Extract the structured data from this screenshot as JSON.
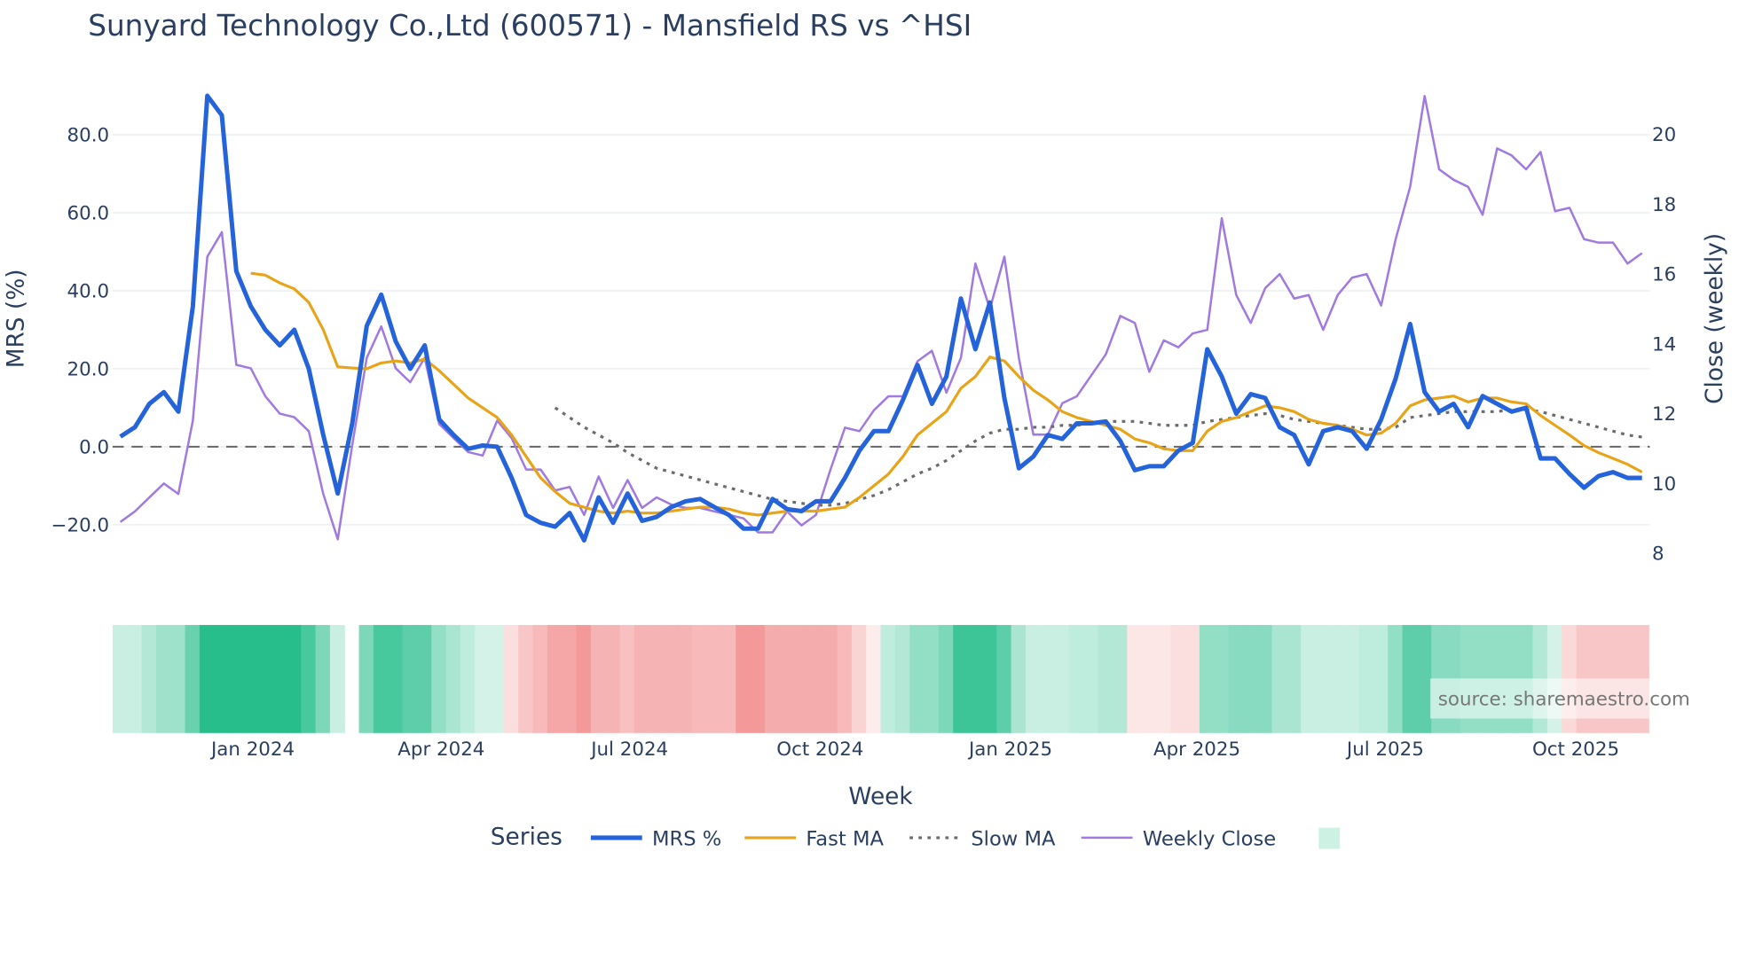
{
  "chart_data": {
    "type": "line",
    "title": "Sunyard Technology Co.,Ltd (600571) - Mansfield RS vs ^HSI",
    "xlabel": "Week",
    "ylabel": "MRS (%)",
    "y2label": "Close (weekly)",
    "x_start": "2023-10-29",
    "x_step_days": 7,
    "ylim": [
      -28,
      92
    ],
    "y2lim": [
      7.7,
      21.4
    ],
    "yticks": [
      "80.0",
      "60.0",
      "40.0",
      "20.0",
      "0.0",
      "−20.0"
    ],
    "ytick_values": [
      80,
      60,
      40,
      20,
      0,
      -20
    ],
    "y2ticks": [
      "20",
      "18",
      "16",
      "14",
      "12",
      "10",
      "8"
    ],
    "y2tick_values": [
      20,
      18,
      16,
      14,
      12,
      10,
      8
    ],
    "xticks": [
      {
        "label": "Jan 2024",
        "date": "2024-01-01"
      },
      {
        "label": "Apr 2024",
        "date": "2024-04-01"
      },
      {
        "label": "Jul 2024",
        "date": "2024-07-01"
      },
      {
        "label": "Oct 2024",
        "date": "2024-10-01"
      },
      {
        "label": "Jan 2025",
        "date": "2025-01-01"
      },
      {
        "label": "Apr 2025",
        "date": "2025-04-01"
      },
      {
        "label": "Jul 2025",
        "date": "2025-07-01"
      },
      {
        "label": "Oct 2025",
        "date": "2025-10-01"
      }
    ],
    "grid": true,
    "legend_title": "Series",
    "legend_placement": "bottom-center",
    "series": [
      {
        "name": "MRS %",
        "axis": "left",
        "color": "#2563db",
        "dash": "solid",
        "width": 4,
        "values": [
          2.6,
          5,
          11,
          14,
          9,
          36,
          90,
          85,
          45,
          36,
          30,
          26,
          30,
          20,
          3,
          -12,
          6,
          31,
          39,
          27,
          20,
          26,
          7,
          3,
          -0.5,
          0.3,
          0,
          -8,
          -17.5,
          -19.5,
          -20.5,
          -17,
          -24,
          -13,
          -19.5,
          -12,
          -19,
          -18,
          -15.5,
          -14,
          -13.4,
          -15.5,
          -17.5,
          -21,
          -21,
          -13.4,
          -16,
          -16.5,
          -14,
          -14,
          -8,
          -1,
          4,
          4,
          12,
          21,
          11,
          18,
          38,
          25,
          37,
          12.5,
          -5.5,
          -2.5,
          3,
          2,
          6,
          6,
          6.5,
          1.5,
          -6,
          -5,
          -5,
          -1,
          1,
          25,
          18,
          8.5,
          13.5,
          12.5,
          5,
          3,
          -4.5,
          4,
          5,
          4,
          -0.5,
          7,
          17.5,
          31.5,
          14,
          9,
          11,
          5,
          13,
          11,
          9,
          10,
          -3,
          -3,
          -7,
          -10.5,
          -7.5,
          -6.5,
          -8,
          -8
        ]
      },
      {
        "name": "Fast MA",
        "axis": "left",
        "color": "#e8a317",
        "dash": "solid",
        "width": 2.5,
        "values": [
          null,
          null,
          null,
          null,
          null,
          null,
          null,
          null,
          null,
          44.5,
          44,
          42,
          40.5,
          37,
          30,
          20.5,
          20.2,
          20,
          21.5,
          22,
          21.5,
          22.5,
          19.5,
          16,
          12.5,
          10,
          7.5,
          3,
          -2.5,
          -8,
          -11.5,
          -14.5,
          -15.5,
          -16.5,
          -17,
          -16.5,
          -17,
          -17,
          -16.5,
          -16,
          -15.5,
          -15.5,
          -16,
          -17,
          -17.5,
          -17,
          -16.5,
          -16.5,
          -16.5,
          -16,
          -15.5,
          -13,
          -10,
          -7,
          -2.5,
          3,
          6,
          9,
          15,
          18,
          23,
          22,
          18,
          14.5,
          12,
          9,
          7.5,
          6.5,
          5.5,
          4.5,
          2,
          1,
          -0.5,
          -1,
          -1,
          4,
          6.5,
          7.5,
          9,
          10.5,
          10,
          9,
          7,
          6,
          5.5,
          4.5,
          3,
          3.5,
          6,
          10.5,
          12,
          12.5,
          13,
          11.5,
          12.5,
          12.5,
          11.5,
          11,
          8,
          5.5,
          3,
          0.3,
          -1.5,
          -3,
          -4.5,
          -6.5
        ]
      },
      {
        "name": "Slow MA",
        "axis": "left",
        "color": "#6b6b6b",
        "dash": "dot",
        "width": 2.5,
        "values": [
          null,
          null,
          null,
          null,
          null,
          null,
          null,
          null,
          null,
          null,
          null,
          null,
          null,
          null,
          null,
          null,
          null,
          null,
          null,
          null,
          null,
          null,
          null,
          null,
          null,
          null,
          null,
          null,
          null,
          null,
          10,
          7.5,
          5,
          3,
          1,
          -1.5,
          -3.5,
          -5.5,
          -6.5,
          -7.5,
          -8.5,
          -9.5,
          -10.5,
          -11.5,
          -12.5,
          -13.5,
          -14,
          -14.5,
          -15,
          -15,
          -14.5,
          -13.5,
          -12.5,
          -11,
          -9,
          -7,
          -5.5,
          -3.5,
          -1,
          1.5,
          3.5,
          4.5,
          4.5,
          5,
          5,
          5.5,
          5.5,
          6,
          6.5,
          6.5,
          6.5,
          6,
          5.5,
          5.5,
          5.5,
          6.5,
          7,
          7.5,
          8,
          8.5,
          8,
          7,
          6.5,
          6,
          5.5,
          5,
          4.5,
          4.5,
          5,
          7.5,
          8,
          8.5,
          9,
          9,
          9,
          9,
          9.5,
          9.5,
          9,
          8,
          7,
          6,
          5,
          4,
          3,
          2.5
        ]
      },
      {
        "name": "Weekly Close",
        "axis": "right",
        "color": "#a07ae0",
        "dash": "solid",
        "width": 2,
        "values": [
          8.9,
          9.2,
          9.6,
          10.0,
          9.7,
          11.8,
          16.5,
          17.2,
          13.4,
          13.3,
          12.5,
          12.0,
          11.9,
          11.5,
          9.7,
          8.4,
          11.1,
          13.6,
          14.5,
          13.3,
          12.9,
          13.6,
          11.7,
          11.3,
          10.9,
          10.8,
          11.8,
          11.3,
          10.4,
          10.4,
          9.8,
          9.9,
          9.1,
          10.2,
          9.3,
          10.1,
          9.3,
          9.6,
          9.4,
          9.3,
          9.3,
          9.2,
          9.1,
          9.0,
          8.6,
          8.6,
          9.2,
          8.8,
          9.1,
          10.4,
          11.6,
          11.5,
          12.1,
          12.5,
          12.5,
          13.5,
          13.8,
          12.6,
          13.6,
          16.3,
          15.0,
          16.5,
          13.6,
          11.4,
          11.4,
          12.3,
          12.5,
          13.1,
          13.7,
          14.8,
          14.6,
          13.2,
          14.1,
          13.9,
          14.3,
          14.4,
          17.6,
          15.4,
          14.6,
          15.6,
          16.0,
          15.3,
          15.4,
          14.4,
          15.4,
          15.9,
          16.0,
          15.1,
          17.0,
          18.5,
          21.1,
          19.0,
          18.7,
          18.5,
          17.7,
          19.6,
          19.4,
          19.0,
          19.5,
          17.8,
          17.9,
          17.0,
          16.9,
          16.9,
          16.3,
          16.6
        ]
      }
    ],
    "regime_band": {
      "legend_label": "",
      "positive_color": "#27be8c",
      "negative_color": "#f08080",
      "values": [
        0.25,
        0.25,
        0.35,
        0.45,
        0.45,
        0.7,
        1,
        1,
        1,
        1,
        1,
        1,
        1,
        0.85,
        0.6,
        0.25,
        null,
        0.6,
        0.85,
        0.85,
        0.75,
        0.75,
        0.5,
        0.4,
        0.3,
        0.2,
        0.2,
        -0.25,
        -0.45,
        -0.55,
        -0.7,
        -0.7,
        -0.8,
        -0.6,
        -0.6,
        -0.5,
        -0.6,
        -0.6,
        -0.6,
        -0.6,
        -0.55,
        -0.55,
        -0.55,
        -0.8,
        -0.8,
        -0.65,
        -0.65,
        -0.65,
        -0.65,
        -0.65,
        -0.55,
        -0.35,
        -0.15,
        0.3,
        0.35,
        0.5,
        0.5,
        0.6,
        0.9,
        0.9,
        0.9,
        0.75,
        0.4,
        0.25,
        0.25,
        0.25,
        0.3,
        0.3,
        0.35,
        0.35,
        -0.2,
        -0.2,
        -0.2,
        -0.25,
        -0.25,
        0.5,
        0.5,
        0.55,
        0.55,
        0.55,
        0.4,
        0.4,
        0.25,
        0.25,
        0.25,
        0.25,
        0.3,
        0.3,
        0.5,
        0.75,
        0.75,
        0.55,
        0.55,
        0.5,
        0.5,
        0.5,
        0.5,
        0.5,
        0.35,
        0.2,
        -0.3,
        -0.45,
        -0.45,
        -0.45,
        -0.45,
        -0.45
      ]
    },
    "watermark": "source: sharemaestro.com"
  }
}
